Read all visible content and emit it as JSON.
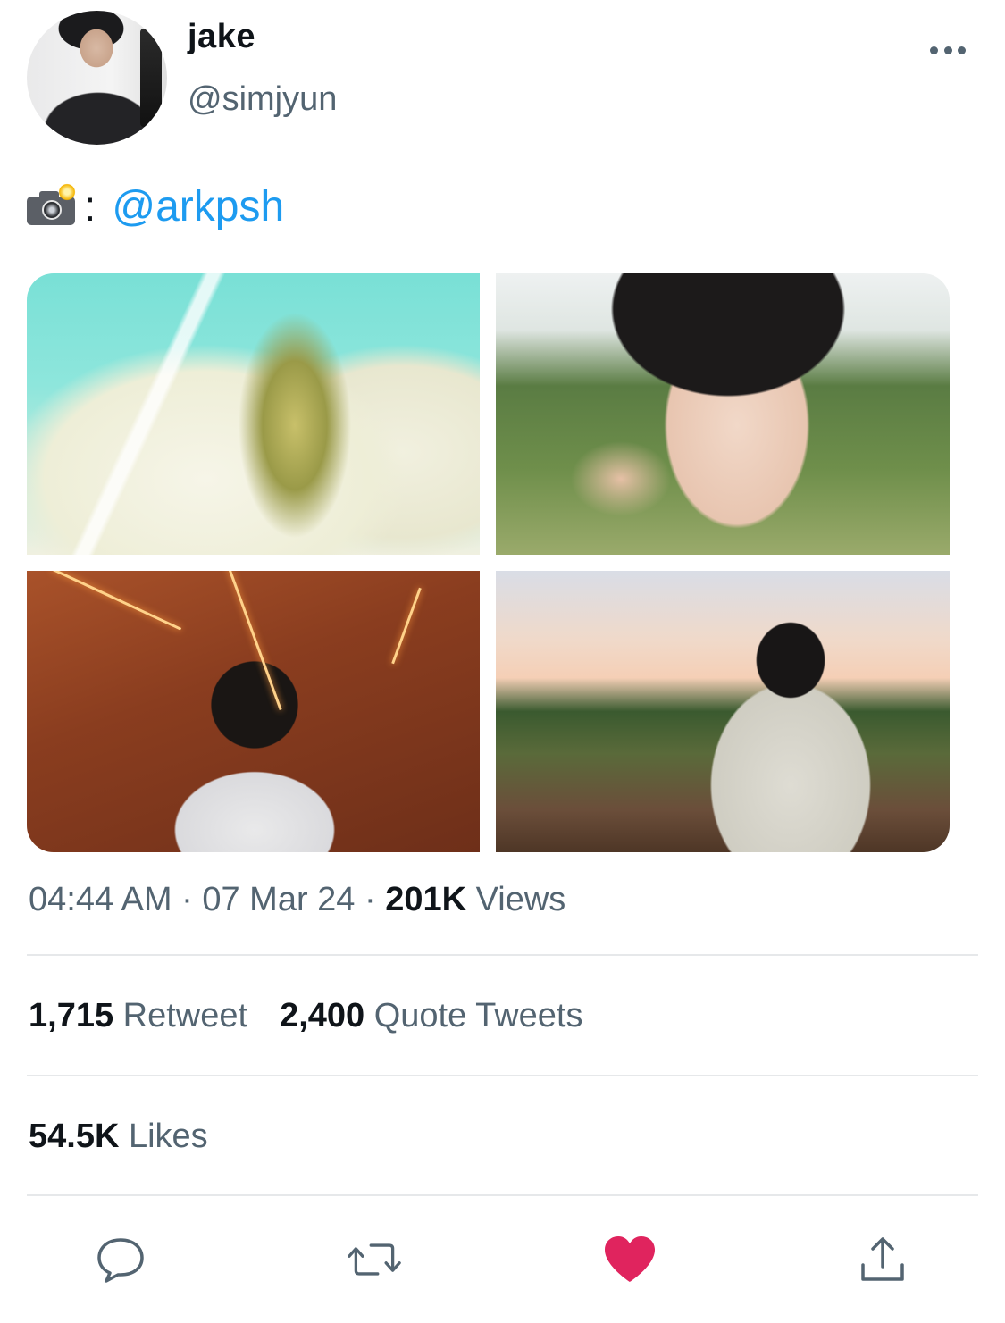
{
  "author": {
    "display_name": "jake",
    "handle": "@simjyun"
  },
  "tweet": {
    "emoji_icon": "camera-with-flash-icon",
    "separator": ":",
    "mention": "@arkpsh"
  },
  "media": {
    "count": 4
  },
  "meta": {
    "time": "04:44 AM",
    "dot1": " · ",
    "date": "07 Mar 24",
    "dot2": " · ",
    "views_count": "201K",
    "views_label": " Views"
  },
  "stats": {
    "retweets_count": "1,715",
    "retweets_label": " Retweet",
    "quotes_count": "2,400",
    "quotes_label": " Quote Tweets",
    "likes_count": "54.5K",
    "likes_label": " Likes"
  },
  "actions": {
    "reply_icon": "reply-icon",
    "retweet_icon": "retweet-icon",
    "like_icon": "heart-icon",
    "like_color": "#e0245e",
    "share_icon": "share-icon"
  },
  "colors": {
    "link": "#1d9bf0",
    "secondary_text": "#536471",
    "primary_text": "#0f1419"
  }
}
